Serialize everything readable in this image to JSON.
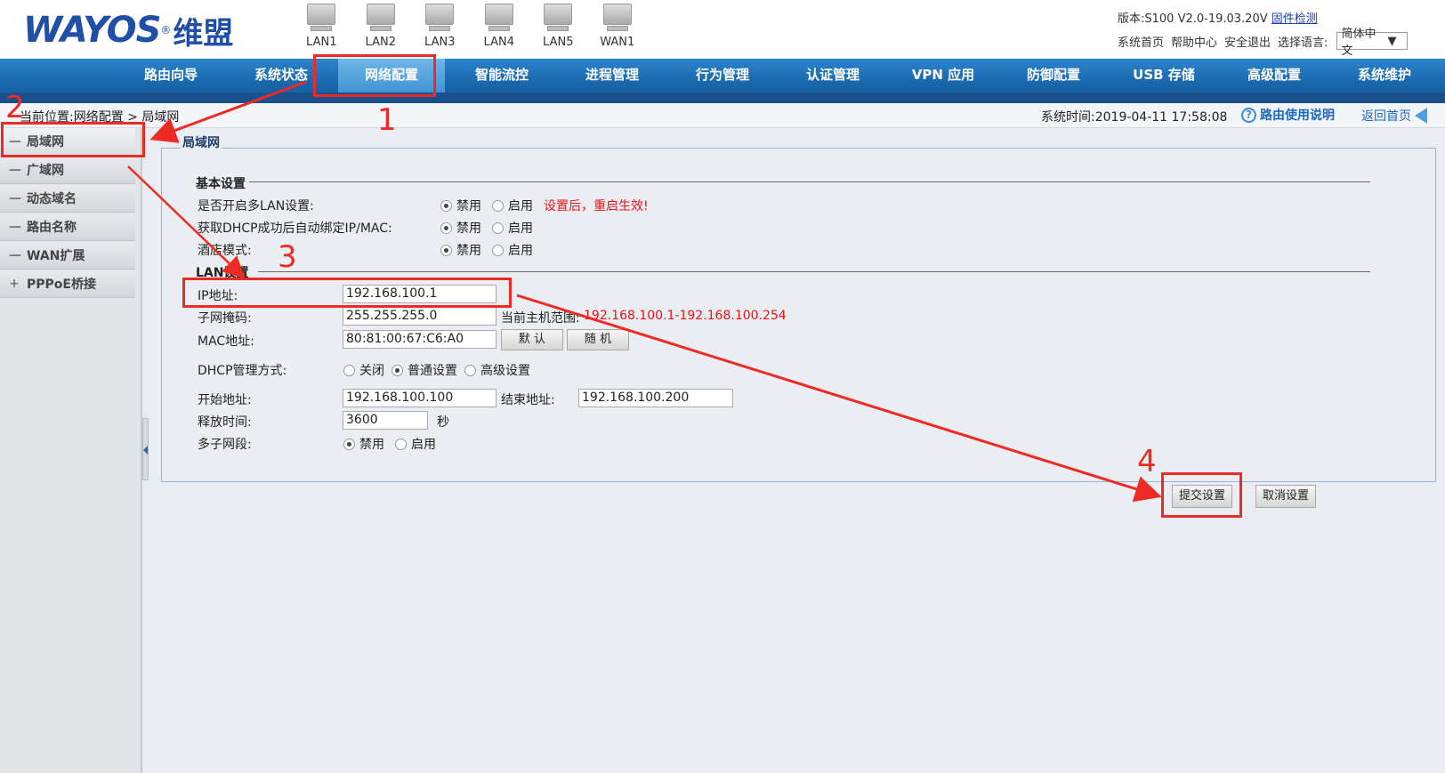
{
  "brand": {
    "logo_text": "WAYOS",
    "logo_reg": "®",
    "logo_cn": "维盟"
  },
  "ports": [
    "LAN1",
    "LAN2",
    "LAN3",
    "LAN4",
    "LAN5",
    "WAN1"
  ],
  "top_right": {
    "version": "版本:S100 V2.0-19.03.20V",
    "firmware_check": "固件检测",
    "links": [
      "系统首页",
      "帮助中心",
      "安全退出",
      "选择语言:"
    ],
    "language": "简体中文"
  },
  "nav": {
    "items": [
      "路由向导",
      "系统状态",
      "网络配置",
      "智能流控",
      "进程管理",
      "行为管理",
      "认证管理",
      "VPN 应用",
      "防御配置",
      "USB 存储",
      "高级配置",
      "系统维护"
    ],
    "active": "网络配置"
  },
  "breadcrumb": "当前位置:网络配置 > 局域网",
  "system_time": "系统时间:2019-04-11 17:58:08",
  "help_link": "路由使用说明",
  "help_icon_glyph": "?",
  "home_link": "返回首页",
  "sidebar": {
    "items": [
      {
        "icon": "—",
        "label": "局域网"
      },
      {
        "icon": "—",
        "label": "广域网"
      },
      {
        "icon": "—",
        "label": "动态域名"
      },
      {
        "icon": "—",
        "label": "路由名称"
      },
      {
        "icon": "—",
        "label": "WAN扩展"
      },
      {
        "icon": "+",
        "label": "PPPoE桥接"
      }
    ]
  },
  "panel": {
    "title": "局域网",
    "basic": {
      "heading": "基本设置",
      "multi_lan": {
        "label": "是否开启多LAN设置:",
        "options": [
          "禁用",
          "启用"
        ],
        "selected": "禁用",
        "note": "设置后，重启生效!"
      },
      "dhcp_bind": {
        "label": "获取DHCP成功后自动绑定IP/MAC:",
        "options": [
          "禁用",
          "启用"
        ],
        "selected": "禁用"
      },
      "hotel_mode": {
        "label": "酒店模式:",
        "options": [
          "禁用",
          "启用"
        ],
        "selected": "禁用"
      }
    },
    "lan": {
      "heading": "LAN设置",
      "ip": {
        "label": "IP地址:",
        "value": "192.168.100.1"
      },
      "mask": {
        "label": "子网掩码:",
        "value": "255.255.255.0",
        "range_label": "当前主机范围:",
        "range": "192.168.100.1-192.168.100.254"
      },
      "mac": {
        "label": "MAC地址:",
        "value": "80:81:00:67:C6:A0",
        "default_btn": "默 认",
        "random_btn": "随 机"
      },
      "dhcp_mode": {
        "label": "DHCP管理方式:",
        "options": [
          "关闭",
          "普通设置",
          "高级设置"
        ],
        "selected": "普通设置"
      },
      "start": {
        "label": "开始地址:",
        "value": "192.168.100.100",
        "end_label": "结束地址:",
        "end_value": "192.168.100.200"
      },
      "lease": {
        "label": "释放时间:",
        "value": "3600",
        "unit": "秒"
      },
      "multi_subnet": {
        "label": "多子网段:",
        "options": [
          "禁用",
          "启用"
        ],
        "selected": "禁用"
      }
    }
  },
  "buttons": {
    "submit": "提交设置",
    "cancel": "取消设置"
  },
  "annotations": [
    "1",
    "2",
    "3",
    "4"
  ],
  "annotation_color": "#ee2a24"
}
